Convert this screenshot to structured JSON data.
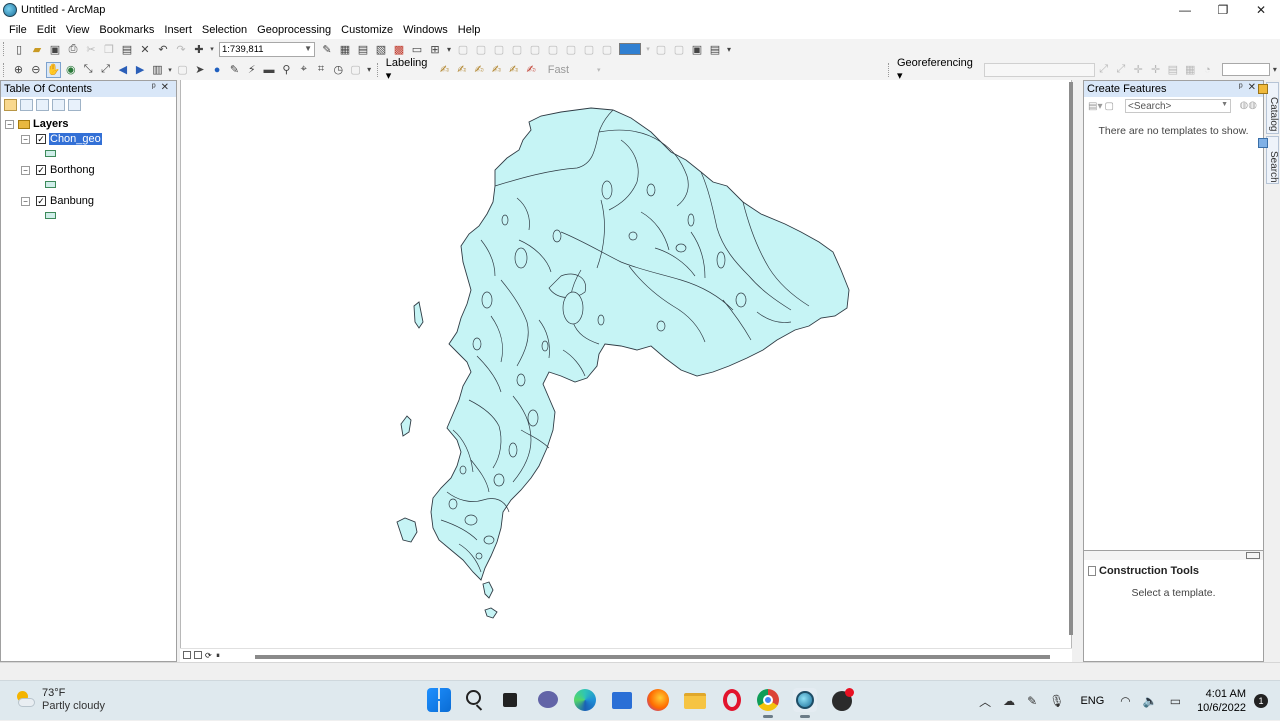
{
  "window": {
    "title": "Untitled - ArcMap",
    "controls": [
      "—",
      "❐",
      "✕"
    ]
  },
  "menu": [
    "File",
    "Edit",
    "View",
    "Bookmarks",
    "Insert",
    "Selection",
    "Geoprocessing",
    "Customize",
    "Windows",
    "Help"
  ],
  "toolbar": {
    "scale": "1:739,811",
    "labeling": "Labeling ▾",
    "fast": "Fast",
    "georeferencing": "Georeferencing ▾"
  },
  "toc": {
    "title": "Table Of Contents",
    "root": "Layers",
    "layers": [
      {
        "name": "Chon_geo",
        "checked": true,
        "selected": true
      },
      {
        "name": "Borthong",
        "checked": true,
        "selected": false
      },
      {
        "name": "Banbung",
        "checked": true,
        "selected": false
      }
    ]
  },
  "create_features": {
    "title": "Create Features",
    "search_placeholder": "<Search>",
    "empty_message": "There are no templates to show.",
    "construction_tools": "Construction Tools",
    "select_template": "Select a template."
  },
  "side_tabs": [
    "Catalog",
    "Search"
  ],
  "map": {
    "fill_color": "#c6f4f5",
    "outline_color": "#2f3b44"
  },
  "taskbar": {
    "weather_temp": "73°F",
    "weather_desc": "Partly cloudy",
    "language": "ENG",
    "time": "4:01 AM",
    "date": "10/6/2022",
    "notification_count": "1"
  }
}
